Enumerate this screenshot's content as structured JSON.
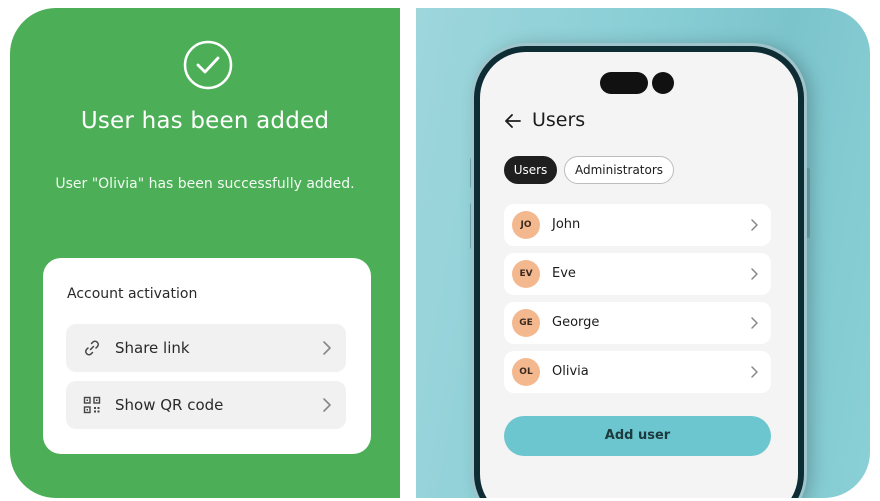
{
  "confirmation": {
    "title": "User has been added",
    "message": "User \"Olivia\" has been successfully added.",
    "icon": "check-circle-icon"
  },
  "activation": {
    "title": "Account activation",
    "options": [
      {
        "label": "Share link",
        "icon": "link-icon"
      },
      {
        "label": "Show QR code",
        "icon": "qr-code-icon"
      }
    ]
  },
  "app": {
    "title": "Users",
    "tabs": [
      {
        "label": "Users",
        "active": true
      },
      {
        "label": "Administrators",
        "active": false
      }
    ],
    "users": [
      {
        "initials": "JO",
        "name": "John"
      },
      {
        "initials": "EV",
        "name": "Eve"
      },
      {
        "initials": "GE",
        "name": "George"
      },
      {
        "initials": "OL",
        "name": "Olivia"
      }
    ],
    "add_button": "Add user"
  },
  "colors": {
    "success_green": "#4caf57",
    "accent_teal": "#6cc6cf",
    "avatar_peach": "#f4b88e",
    "active_tab": "#1f1f1f"
  }
}
